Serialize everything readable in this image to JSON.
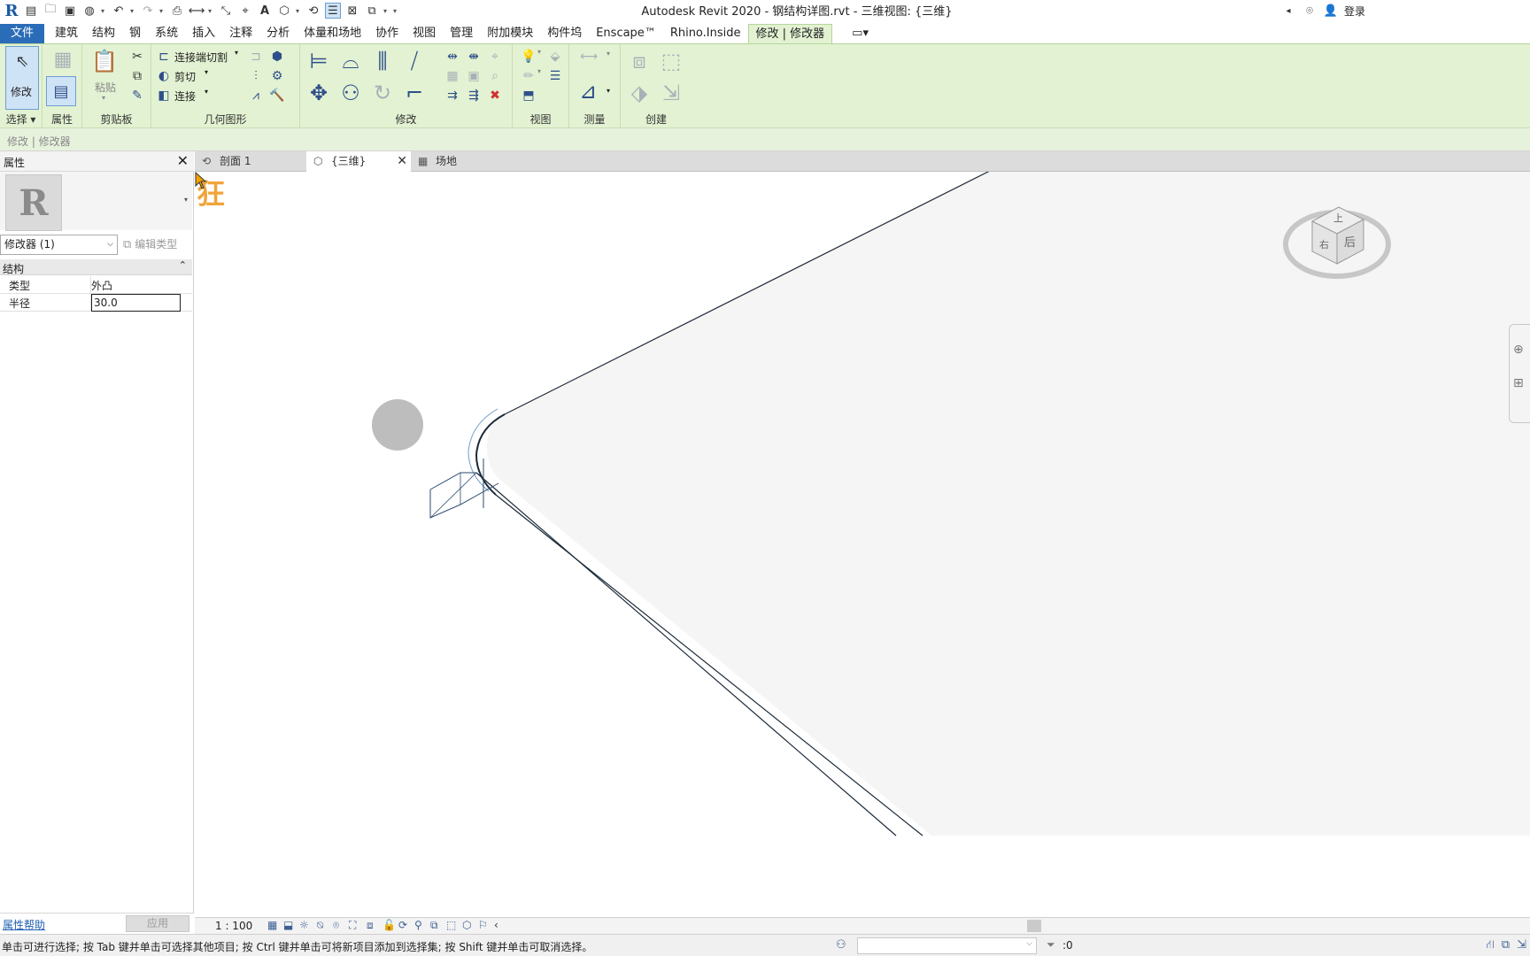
{
  "window": {
    "title": "Autodesk Revit 2020 - 钢结构详图.rvt - 三维视图: {三维}",
    "sign_in_label": "登录"
  },
  "quick_access": {
    "icons": [
      "revit-logo-icon",
      "open-icon",
      "save-icon",
      "sync-icon",
      "undo-icon",
      "redo-icon",
      "print-icon",
      "measure-icon",
      "dimension-icon",
      "tag-icon",
      "text-icon",
      "3d-view-icon",
      "section-icon",
      "thin-lines-icon",
      "close-hidden-icon",
      "switch-windows-icon",
      "customize-icon"
    ]
  },
  "ribbon_tabs": [
    {
      "label": "文件",
      "kind": "file"
    },
    {
      "label": "建筑"
    },
    {
      "label": "结构"
    },
    {
      "label": "钢"
    },
    {
      "label": "系统"
    },
    {
      "label": "插入"
    },
    {
      "label": "注释"
    },
    {
      "label": "分析"
    },
    {
      "label": "体量和场地"
    },
    {
      "label": "协作"
    },
    {
      "label": "视图"
    },
    {
      "label": "管理"
    },
    {
      "label": "附加模块"
    },
    {
      "label": "构件坞"
    },
    {
      "label": "Enscape™"
    },
    {
      "label": "Rhino.Inside"
    },
    {
      "label": "修改 | 修改器",
      "kind": "active"
    }
  ],
  "ribbon": {
    "modify_label": "修改",
    "panels": {
      "select": "选择",
      "properties": "属性",
      "clipboard": "剪贴板",
      "geometry": "几何图形",
      "modify": "修改",
      "view": "视图",
      "measure": "测量",
      "create": "创建"
    },
    "clipboard": {
      "paste_label": "粘贴"
    },
    "geometry": {
      "cope_label": "连接端切割",
      "cut_label": "剪切",
      "join_label": "连接"
    }
  },
  "options_bar": {
    "text": "修改 | 修改器"
  },
  "properties": {
    "title": "属性",
    "type_image_icon": "revit-r-icon",
    "instance_filter": "修改器 (1)",
    "edit_type_label": "编辑类型",
    "group_name": "结构",
    "rows": [
      {
        "key": "类型",
        "value": "外凸"
      },
      {
        "key": "半径",
        "value": "30.0"
      }
    ],
    "help_link": "属性帮助",
    "apply_label": "应用"
  },
  "view_tabs": [
    {
      "label": "剖面 1",
      "icon": "section-view-icon"
    },
    {
      "label": "{三维}",
      "icon": "3d-view-icon",
      "active": true
    },
    {
      "label": "场地",
      "icon": "site-plan-icon"
    }
  ],
  "viewport": {
    "watermark": "狂",
    "viewcube_labels": {
      "top": "上",
      "front": "后",
      "right": "右"
    },
    "background_color": "#ffffff",
    "floor_fill_color": "#f5f5f5",
    "line_color": "#1c2a3a"
  },
  "view_control": {
    "scale": "1 : 100"
  },
  "status": {
    "message": "单击可进行选择; 按 Tab 键并单击可选择其他项目; 按 Ctrl 键并单击可将新项目添加到选择集; 按 Shift 键并单击可取消选择。",
    "filter_count": ":0"
  }
}
